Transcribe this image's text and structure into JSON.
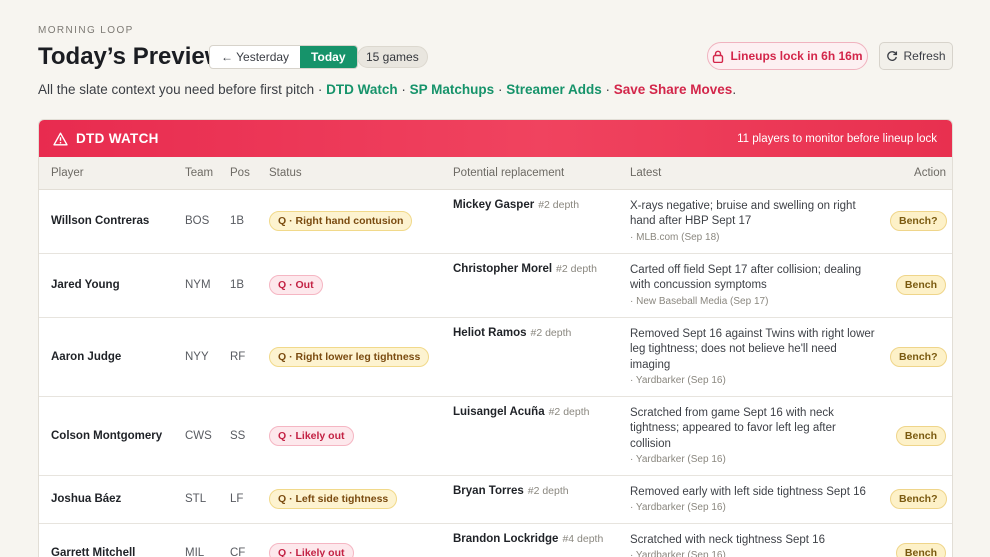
{
  "header": {
    "eyebrow": "MORNING LOOP",
    "title": "Today’s Preview",
    "seg_yesterday": "← Yesterday",
    "seg_today": "Today",
    "games_badge": "15 games",
    "lock_label": "Lineups lock in 6h 16m",
    "refresh_label": "Refresh"
  },
  "subline": {
    "prefix": "All the slate context you need before first pitch · ",
    "link1": "DTD Watch",
    "sep1": " · ",
    "link2": "SP Matchups",
    "sep2": " · ",
    "link3": "Streamer Adds",
    "sep3": " · ",
    "link4": "Save Share Moves",
    "suffix": "."
  },
  "dtd": {
    "title": "DTD WATCH",
    "note": "11 players to monitor before lineup lock",
    "columns": [
      "Player",
      "Team",
      "Pos",
      "Status",
      "Potential replacement",
      "Latest",
      "Action"
    ],
    "rows": [
      {
        "player": "Willson Contreras",
        "team": "BOS",
        "pos": "1B",
        "status": "Q · Right hand contusion",
        "tone": "amber",
        "rep": "Mickey Gasper",
        "depth": "#2 depth",
        "latest": "X-rays negative; bruise and swelling on right hand after HBP Sept 17",
        "source": "· MLB.com (Sep 18)",
        "action": "Bench?"
      },
      {
        "player": "Jared Young",
        "team": "NYM",
        "pos": "1B",
        "status": "Q · Out",
        "tone": "red",
        "rep": "Christopher Morel",
        "depth": "#2 depth",
        "latest": "Carted off field Sept 17 after collision; dealing with concussion symptoms",
        "source": "· New Baseball Media (Sep 17)",
        "action": "Bench"
      },
      {
        "player": "Aaron Judge",
        "team": "NYY",
        "pos": "RF",
        "status": "Q · Right lower leg tightness",
        "tone": "amber",
        "rep": "Heliot Ramos",
        "depth": "#2 depth",
        "latest": "Removed Sept 16 against Twins with right lower leg tightness; does not believe he'll need imaging",
        "source": "· Yardbarker (Sep 16)",
        "action": "Bench?"
      },
      {
        "player": "Colson Montgomery",
        "team": "CWS",
        "pos": "SS",
        "status": "Q · Likely out",
        "tone": "red",
        "rep": "Luisangel Acuña",
        "depth": "#2 depth",
        "latest": "Scratched from game Sept 16 with neck tightness; appeared to favor left leg after collision",
        "source": "· Yardbarker (Sep 16)",
        "action": "Bench"
      },
      {
        "player": "Joshua Báez",
        "team": "STL",
        "pos": "LF",
        "status": "Q · Left side tightness",
        "tone": "amber",
        "rep": "Bryan Torres",
        "depth": "#2 depth",
        "latest": "Removed early with left side tightness Sept 16",
        "source": "· Yardbarker (Sep 16)",
        "action": "Bench?"
      },
      {
        "player": "Garrett Mitchell",
        "team": "MIL",
        "pos": "CF",
        "status": "Q · Likely out",
        "tone": "red",
        "rep": "Brandon Lockridge",
        "depth": "#4 depth",
        "latest": "Scratched with neck tightness Sept 16",
        "source": "· Yardbarker (Sep 16)",
        "action": "Bench"
      }
    ]
  },
  "colors": {
    "accent_green": "#16936a",
    "alert_red": "#e82b4f",
    "amber": "#fdf3d0"
  },
  "icons": {
    "lock": "lock-icon",
    "refresh": "refresh-icon",
    "warning": "warning-icon"
  }
}
